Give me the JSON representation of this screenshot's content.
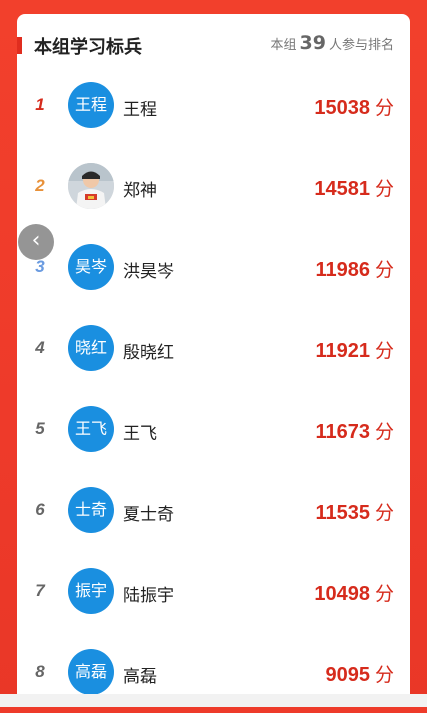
{
  "header": {
    "title": "本组学习标兵",
    "meta_prefix": "本组",
    "participant_count": "39",
    "meta_suffix": "人参与排名"
  },
  "rows": [
    {
      "rank": "1",
      "avatar_text": "王程",
      "name": "王程",
      "score": "15038",
      "unit": "分",
      "rank_color": "#d62b1c"
    },
    {
      "rank": "2",
      "avatar_text": "",
      "name": "郑神",
      "score": "14581",
      "unit": "分",
      "rank_color": "#e8913a",
      "avatar_photo": true
    },
    {
      "rank": "3",
      "avatar_text": "昊岑",
      "name": "洪昊岑",
      "score": "11986",
      "unit": "分",
      "rank_color": "#6a9be0"
    },
    {
      "rank": "4",
      "avatar_text": "晓红",
      "name": "殷晓红",
      "score": "11921",
      "unit": "分",
      "rank_color": "#666666"
    },
    {
      "rank": "5",
      "avatar_text": "王飞",
      "name": "王飞",
      "score": "11673",
      "unit": "分",
      "rank_color": "#666666"
    },
    {
      "rank": "6",
      "avatar_text": "士奇",
      "name": "夏士奇",
      "score": "11535",
      "unit": "分",
      "rank_color": "#666666"
    },
    {
      "rank": "7",
      "avatar_text": "振宇",
      "name": "陆振宇",
      "score": "10498",
      "unit": "分",
      "rank_color": "#666666"
    },
    {
      "rank": "8",
      "avatar_text": "高磊",
      "name": "高磊",
      "score": "9095",
      "unit": "分",
      "rank_color": "#666666"
    }
  ],
  "back_button": {
    "icon": "chevron-left-icon",
    "glyph": "‹"
  },
  "colors": {
    "background": "#ee3b2a",
    "accent": "#d62b1c",
    "avatar": "#1a8fe0"
  }
}
